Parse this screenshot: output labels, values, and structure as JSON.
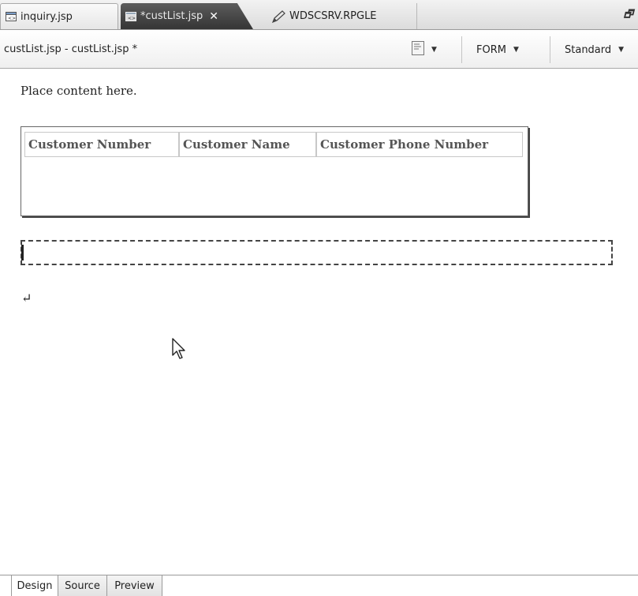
{
  "tabs": [
    {
      "label": "inquiry.jsp",
      "icon": "jsp-file-icon",
      "active": false
    },
    {
      "label": "*custList.jsp",
      "icon": "jsp-file-icon",
      "active": true,
      "close": "✕"
    },
    {
      "label": "WDSCSRV.RPGLE",
      "icon": "pencil-icon",
      "active": false
    }
  ],
  "restore_glyph": "🗗",
  "editor": {
    "title": "custList.jsp - custList.jsp *",
    "toolbar": {
      "form_label": "FORM",
      "standard_label": "Standard"
    }
  },
  "canvas": {
    "placeholder_text": "Place content here.",
    "table": {
      "headers": [
        "Customer Number",
        "Customer Name",
        "Customer Phone Number"
      ]
    },
    "return_glyph": "↵"
  },
  "bottom_tabs": [
    {
      "label": "Design",
      "active": true
    },
    {
      "label": "Source",
      "active": false
    },
    {
      "label": "Preview",
      "active": false
    }
  ]
}
